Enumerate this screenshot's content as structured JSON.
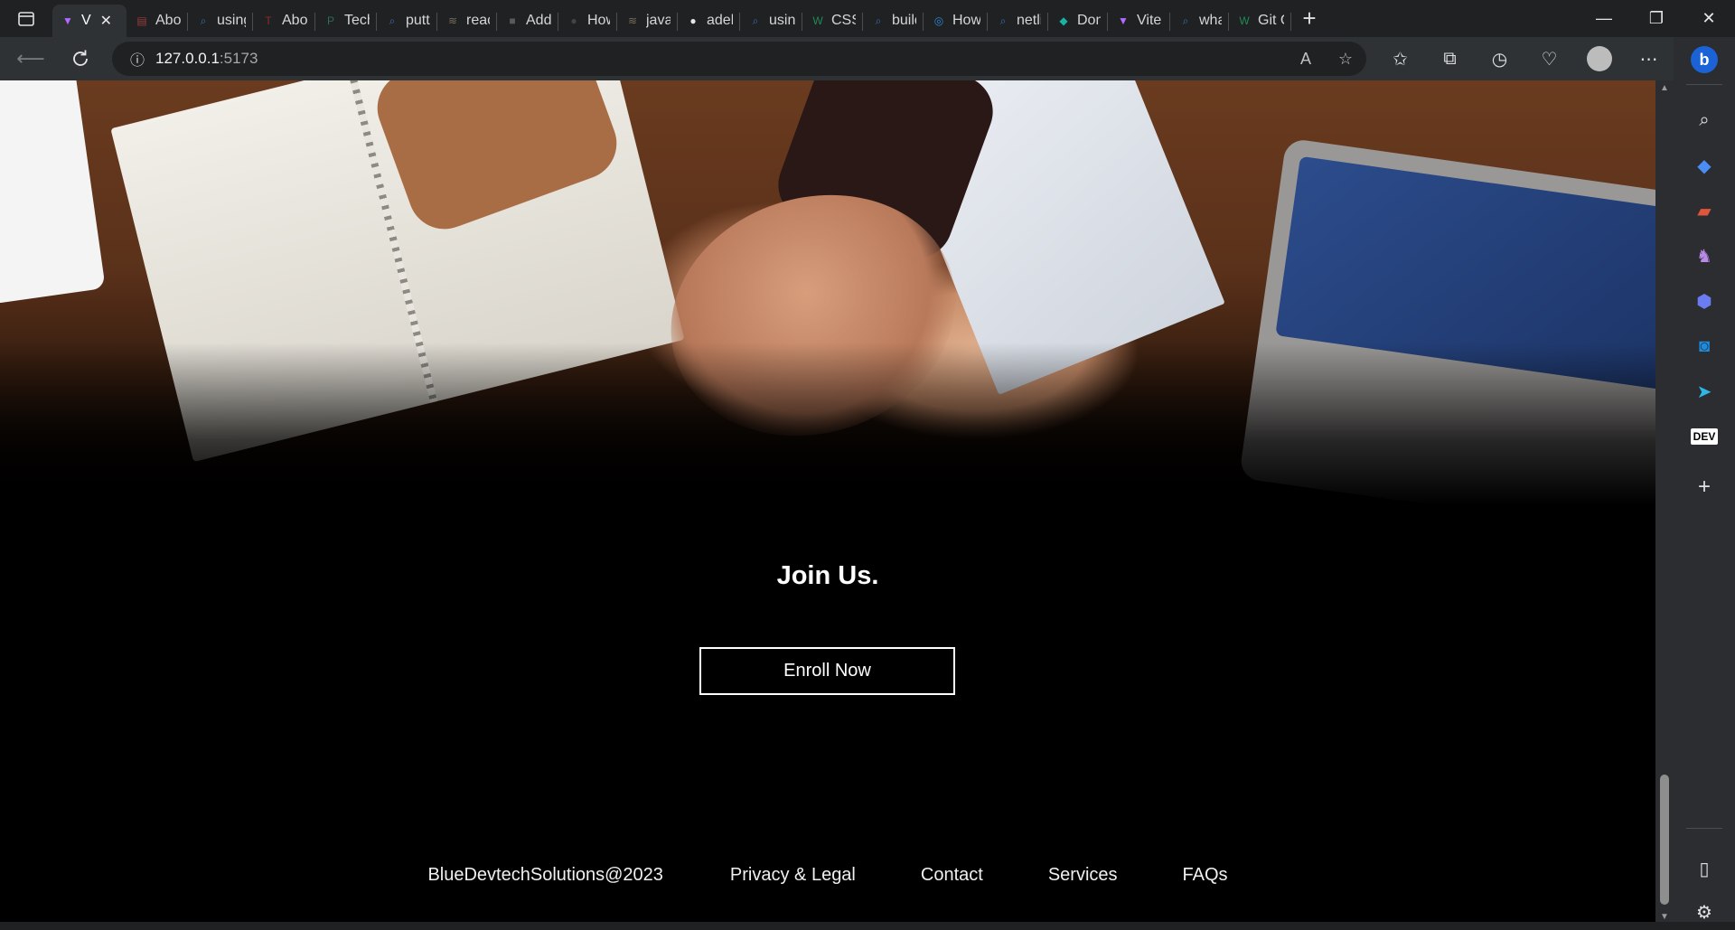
{
  "browser": {
    "tabs": [
      {
        "title": "V",
        "active": true,
        "fav_color": "#b26bff",
        "fav_glyph": "▼"
      },
      {
        "title": "Abou",
        "fav_color": "#9b3a3a",
        "fav_glyph": "▤"
      },
      {
        "title": "using",
        "fav_color": "#3d6fb0",
        "fav_glyph": "⌕"
      },
      {
        "title": "Abou",
        "fav_color": "#8c2b2b",
        "fav_glyph": "T"
      },
      {
        "title": "Tech",
        "fav_color": "#2e6b5c",
        "fav_glyph": "P"
      },
      {
        "title": "puttir",
        "fav_color": "#3d6fb0",
        "fav_glyph": "⌕"
      },
      {
        "title": "react",
        "fav_color": "#7a6d5a",
        "fav_glyph": "≋"
      },
      {
        "title": "Add",
        "fav_color": "#5a5a5a",
        "fav_glyph": "■"
      },
      {
        "title": "How",
        "fav_color": "#444444",
        "fav_glyph": "●"
      },
      {
        "title": "javas",
        "fav_color": "#7a6d5a",
        "fav_glyph": "≋"
      },
      {
        "title": "adeb",
        "fav_color": "#e6e6e6",
        "fav_glyph": "●"
      },
      {
        "title": "using",
        "fav_color": "#3d6fb0",
        "fav_glyph": "⌕"
      },
      {
        "title": "CSS (",
        "fav_color": "#1f8a55",
        "fav_glyph": "W"
      },
      {
        "title": "build",
        "fav_color": "#3d6fb0",
        "fav_glyph": "⌕"
      },
      {
        "title": "How",
        "fav_color": "#2f86d6",
        "fav_glyph": "◎"
      },
      {
        "title": "netlif",
        "fav_color": "#3d6fb0",
        "fav_glyph": "⌕"
      },
      {
        "title": "Dom",
        "fav_color": "#17b3a3",
        "fav_glyph": "◆"
      },
      {
        "title": "Vite",
        "fav_color": "#b26bff",
        "fav_glyph": "▼"
      },
      {
        "title": "what",
        "fav_color": "#3d6fb0",
        "fav_glyph": "⌕"
      },
      {
        "title": "Git C",
        "fav_color": "#1f8a55",
        "fav_glyph": "W"
      }
    ],
    "address": {
      "host": "127.0.0.1",
      "port": ":5173"
    }
  },
  "page": {
    "cta_title": "Join Us.",
    "cta_button": "Enroll Now",
    "footer": {
      "copyright": "BlueDevtechSolutions@2023",
      "links": [
        "Privacy & Legal",
        "Contact",
        "Services",
        "FAQs"
      ]
    }
  },
  "sidebar_icons": [
    "search-icon",
    "shopping-tag-icon",
    "toolbox-icon",
    "games-icon",
    "microsoft-365-icon",
    "outlook-icon",
    "drop-icon",
    "dev-icon",
    "add-icon"
  ]
}
